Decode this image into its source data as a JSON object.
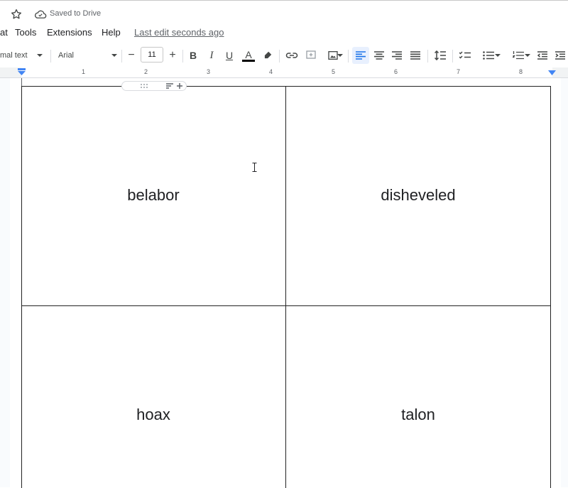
{
  "header": {
    "saved_status": "Saved to Drive"
  },
  "menu": {
    "items": [
      "at",
      "Tools",
      "Extensions",
      "Help"
    ],
    "last_edit": "Last edit seconds ago"
  },
  "toolbar": {
    "paragraph_style": "mal text",
    "font_family": "Arial",
    "font_size": "11",
    "decrease_size": "−",
    "increase_size": "+",
    "bold": "B",
    "italic": "I",
    "underline": "U",
    "text_color_label": "A",
    "text_color": "#000000",
    "active_alignment": "left",
    "accent": "#1a73e8"
  },
  "ruler": {
    "marks": [
      "1",
      "2",
      "3",
      "4",
      "5",
      "6",
      "7",
      "8"
    ]
  },
  "table": {
    "cells": [
      [
        "belabor",
        "disheveled"
      ],
      [
        "hoax",
        "talon"
      ]
    ]
  }
}
